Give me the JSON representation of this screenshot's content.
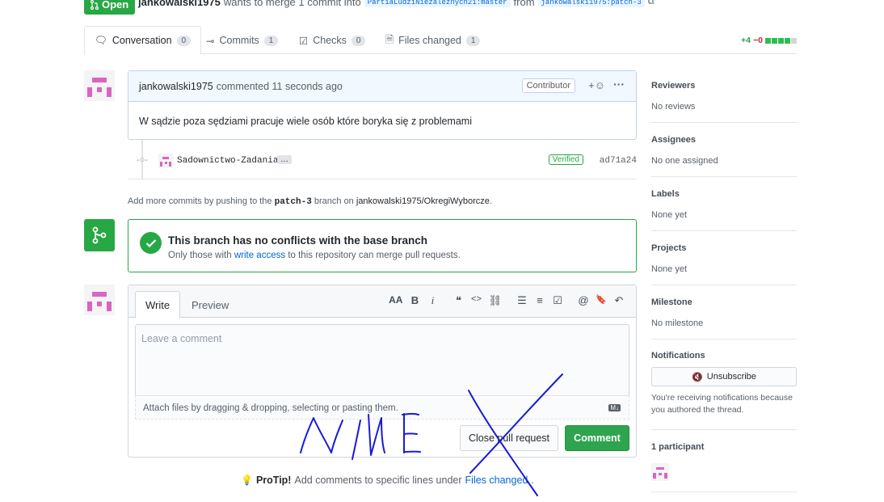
{
  "header": {
    "state": "Open",
    "author": "jankowalski1975",
    "merge_text": "wants to merge 1 commit into",
    "base_branch": "PartiaLudziNiezaleznych21:master",
    "from_text": "from",
    "head_branch": "jankowalski1975:patch-3"
  },
  "tabs": [
    {
      "label": "Conversation",
      "count": "0"
    },
    {
      "label": "Commits",
      "count": "1"
    },
    {
      "label": "Checks",
      "count": "0"
    },
    {
      "label": "Files changed",
      "count": "1"
    }
  ],
  "diffstat": {
    "additions": "+4",
    "deletions": "−0",
    "colors": [
      "#2cbe4e",
      "#2cbe4e",
      "#2cbe4e",
      "#2cbe4e",
      "#d1d5da"
    ]
  },
  "comment": {
    "author": "jankowalski1975",
    "action": "commented",
    "time": "11 seconds ago",
    "role": "Contributor",
    "body": "W sądzie poza sędziami pracuje wiele osób które boryka się z problemami"
  },
  "commit": {
    "message": "Sadownictwo-Zadania",
    "ellipsis": "…",
    "verified": "Verified",
    "sha": "ad71a24"
  },
  "push_info": {
    "prefix": "Add more commits by pushing to the",
    "branch": "patch-3",
    "mid": "branch on",
    "repo": "jankowalski1975/OkregiWyborcze",
    "suffix": "."
  },
  "merge_status": {
    "title": "This branch has no conflicts with the base branch",
    "sub_prefix": "Only those with",
    "sub_link": "write access",
    "sub_suffix": "to this repository can merge pull requests."
  },
  "form": {
    "tab_write": "Write",
    "tab_preview": "Preview",
    "placeholder": "Leave a comment",
    "attach_text": "Attach files by dragging & dropping, selecting or pasting them.",
    "md_badge": "M↓",
    "close_button": "Close pull request",
    "comment_button": "Comment"
  },
  "toolbar": [
    "AA",
    "B",
    "i",
    "❝",
    "<>",
    "⛓",
    "☰",
    "≡",
    "☑",
    "@",
    "🔖",
    "↶"
  ],
  "protip": {
    "bold": "ProTip!",
    "text": "Add comments to specific lines under",
    "link": "Files changed",
    "suffix": "."
  },
  "sidebar": {
    "reviewers": {
      "title": "Reviewers",
      "value": "No reviews"
    },
    "assignees": {
      "title": "Assignees",
      "value": "No one assigned"
    },
    "labels": {
      "title": "Labels",
      "value": "None yet"
    },
    "projects": {
      "title": "Projects",
      "value": "None yet"
    },
    "milestone": {
      "title": "Milestone",
      "value": "No milestone"
    },
    "notifications": {
      "title": "Notifications",
      "button": "Unsubscribe",
      "text": "You're receiving notifications because you authored the thread."
    },
    "participants": {
      "title": "1 participant"
    }
  },
  "colors": {
    "green": "#28a745",
    "blue_link": "#0366d6",
    "avatar_pink": "#d865c0",
    "scribble": "#1a1ad6"
  }
}
